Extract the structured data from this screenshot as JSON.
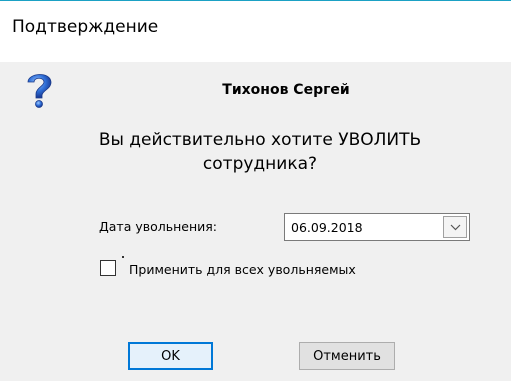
{
  "dialog": {
    "title": "Подтверждение",
    "icon": "question-icon",
    "employee_name": "Тихонов Сергей",
    "question": "Вы действительно хотите УВОЛИТЬ сотрудника?"
  },
  "form": {
    "date_label": "Дата увольнения:",
    "date_value": "06.09.2018",
    "apply_all_label": "Применить для всех увольняемых",
    "apply_all_checked": false
  },
  "buttons": {
    "ok_label": "OK",
    "cancel_label": "Отменить"
  },
  "colors": {
    "accent": "#1ba1c4",
    "focus_border": "#0078d7",
    "dialog_bg": "#f0f0f0"
  }
}
